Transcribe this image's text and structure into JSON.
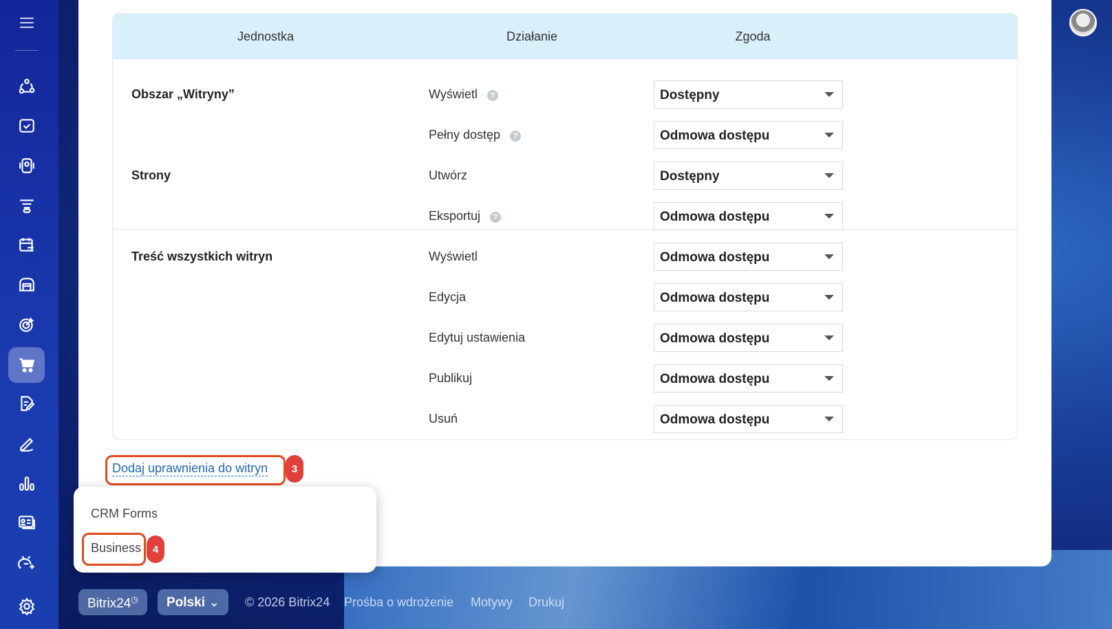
{
  "table": {
    "headers": [
      "Jednostka",
      "Działanie",
      "Zgoda"
    ],
    "groups": [
      {
        "entity": "Obszar „Witryny”"
      },
      {
        "entity": "Strony"
      },
      {
        "entity": "Treść wszystkich witryn"
      }
    ],
    "rows": [
      {
        "action": "Wyświetl",
        "help": true,
        "value": "Dostępny"
      },
      {
        "action": "Pełny dostęp",
        "help": true,
        "value": "Odmowa dostępu"
      },
      {
        "action": "Utwórz",
        "help": false,
        "value": "Dostępny"
      },
      {
        "action": "Eksportuj",
        "help": true,
        "value": "Odmowa dostępu"
      },
      {
        "action": "Wyświetl",
        "help": false,
        "value": "Odmowa dostępu"
      },
      {
        "action": "Edycja",
        "help": false,
        "value": "Odmowa dostępu"
      },
      {
        "action": "Edytuj ustawienia",
        "help": false,
        "value": "Odmowa dostępu"
      },
      {
        "action": "Publikuj",
        "help": false,
        "value": "Odmowa dostępu"
      },
      {
        "action": "Usuń",
        "help": false,
        "value": "Odmowa dostępu"
      }
    ]
  },
  "help_glyph": "?",
  "add_link": "Dodaj uprawnienia do witryn",
  "badges": {
    "step3": "3",
    "step4": "4"
  },
  "popup": {
    "items": [
      "CRM Forms",
      "Business"
    ]
  },
  "footer": {
    "bitrix_btn": "Bitrix24",
    "clock": "◷",
    "lang": "Polski",
    "copyright": "© 2026 Bitrix24",
    "links": [
      "Prośba o wdrożenie",
      "Motywy",
      "Drukuj"
    ]
  },
  "colors": {
    "accent": "#e04a1e",
    "header": "#d9effa",
    "link": "#2067b0"
  }
}
